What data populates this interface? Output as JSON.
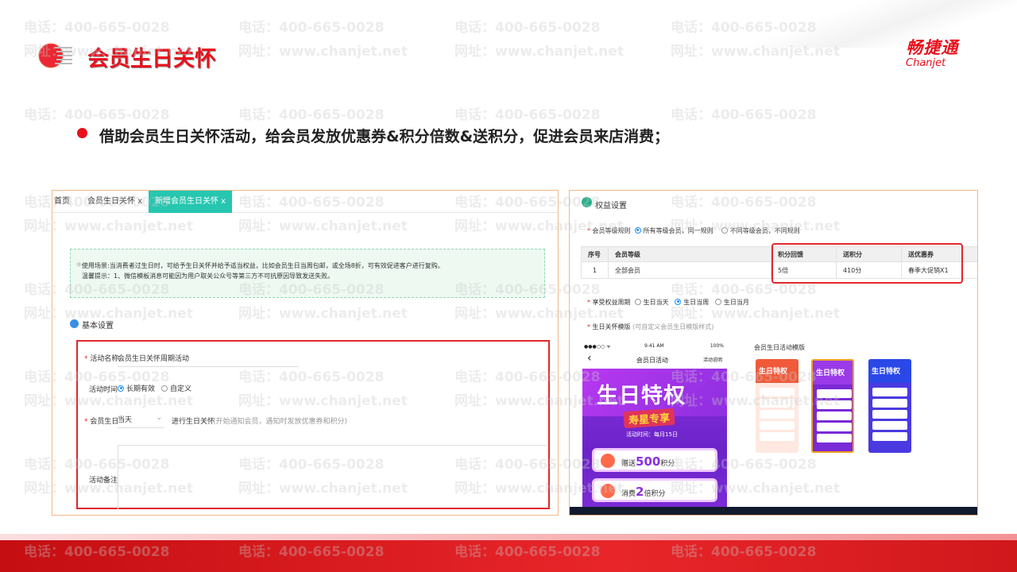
{
  "page_title": "会员生日关怀",
  "brand": {
    "cn": "畅捷通",
    "en": "Chanjet"
  },
  "subtitle": "借助会员生日关怀活动，给会员发放优惠券&积分倍数&送积分，促进会员来店消费；",
  "watermark": {
    "phone": "电话：400-665-0028",
    "site": "网址：www.chanjet.net"
  },
  "left_panel": {
    "tabs": [
      {
        "label": "首页"
      },
      {
        "label": "会员生日关怀 x"
      },
      {
        "label": "新增会员生日关怀 x"
      }
    ],
    "info": {
      "line1": "使用场景:当消费者过生日时，可给予生日关怀并给予适当权益，比如会员生日当周包邮，或全场8折，可有效促进客户进行复购。",
      "line2": "温馨提示：1、微信模板消息可能因为用户取关公众号等第三方不可抗原因导致发送失败。"
    },
    "section_title": "基本设置",
    "form": {
      "name_label": "活动名称",
      "name_value": "会员生日关怀周期活动",
      "time_label": "活动时间",
      "time_opt1": "长期有效",
      "time_opt2": "自定义",
      "birthday_label": "会员生日",
      "birthday_value": "当天",
      "birthday_suffix": "进行生日关怀",
      "birthday_hint": "(开始通知会员，遇知时发放优惠券和积分)",
      "remark_label": "活动备注"
    }
  },
  "right_panel": {
    "title": "权益设置",
    "rule_label": "会员等级规则",
    "rule_opt1": "所有等级会员，同一规则",
    "rule_opt2": "不同等级会员，不同规则",
    "table": {
      "headers": [
        "序号",
        "会员等级",
        "积分回馈",
        "送积分",
        "送优惠券"
      ],
      "rows": [
        [
          "1",
          "全部会员",
          "5倍",
          "410分",
          "春季大促销X1"
        ]
      ]
    },
    "period_label": "享受权益周期",
    "period_opts": [
      "生日当天",
      "生日当周",
      "生日当月"
    ],
    "template_label": "生日关怀模版",
    "template_hint": "(可自定义会员生日模版样式)",
    "template_gallery_title": "会员生日活动模版",
    "phone": {
      "time": "9:41 AM",
      "battery": "100%",
      "nav_title": "会员日活动",
      "nav_right": "活动说明",
      "hero_title": "生日特权",
      "hero_sub": "寿星专享",
      "hero_time": "活动时间：每月15日",
      "gift1_pre": "赠送",
      "gift1_num": "500",
      "gift1_post": "积分",
      "gift2_pre": "消费",
      "gift2_num": "2",
      "gift2_post": "倍积分"
    },
    "thumbs": [
      {
        "title": "生日特权",
        "color": "#f05a3a"
      },
      {
        "title": "生日特权",
        "color": "#8a2ee0"
      },
      {
        "title": "生日特权",
        "color": "#3a3ae0"
      }
    ]
  },
  "colors": {
    "brand_red": "#e8101c",
    "tab_active": "#26c6b0",
    "highlight_box": "#e0282c"
  }
}
